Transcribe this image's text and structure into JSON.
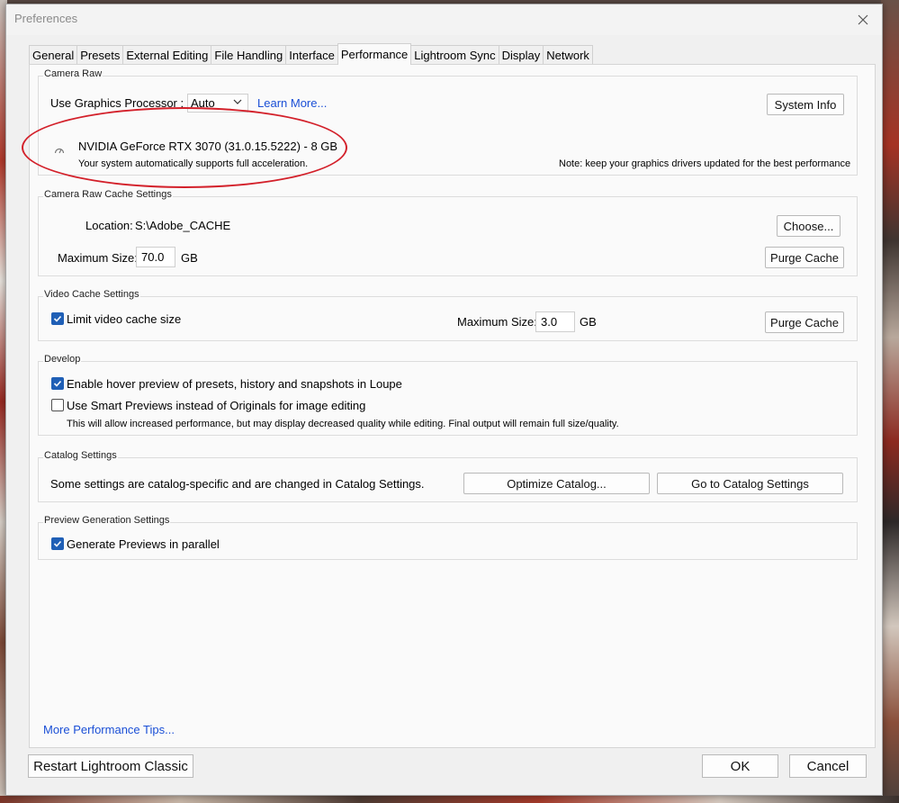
{
  "window": {
    "title": "Preferences"
  },
  "tabs": [
    {
      "label": "General",
      "active": false
    },
    {
      "label": "Presets",
      "active": false
    },
    {
      "label": "External Editing",
      "active": false
    },
    {
      "label": "File Handling",
      "active": false
    },
    {
      "label": "Interface",
      "active": false
    },
    {
      "label": "Performance",
      "active": true
    },
    {
      "label": "Lightroom Sync",
      "active": false
    },
    {
      "label": "Display",
      "active": false
    },
    {
      "label": "Network",
      "active": false
    }
  ],
  "camera_raw": {
    "section_label": "Camera Raw",
    "gpu_label": "Use Graphics Processor :",
    "gpu_select_value": "Auto",
    "learn_more": "Learn More...",
    "system_info_button": "System Info",
    "gpu_name": "NVIDIA GeForce RTX 3070 (31.0.15.5222) - 8 GB",
    "gpu_status": "Your system automatically supports full acceleration.",
    "driver_note": "Note: keep your graphics drivers updated for the best performance"
  },
  "cache": {
    "section_label": "Camera Raw Cache Settings",
    "location_label": "Location:",
    "location_value": "S:\\Adobe_CACHE",
    "choose_button": "Choose...",
    "max_size_label": "Maximum Size:",
    "max_size_value": "70.0",
    "unit": "GB",
    "purge_button": "Purge Cache"
  },
  "video_cache": {
    "section_label": "Video Cache Settings",
    "limit_label": "Limit video cache size",
    "limit_checked": true,
    "max_size_label": "Maximum Size:",
    "max_size_value": "3.0",
    "unit": "GB",
    "purge_button": "Purge Cache"
  },
  "develop": {
    "section_label": "Develop",
    "hover_label": "Enable hover preview of presets, history and snapshots in Loupe",
    "hover_checked": true,
    "smart_label": "Use Smart Previews instead of Originals for image editing",
    "smart_checked": false,
    "smart_note": "This will allow increased performance, but may display decreased quality while editing. Final output will remain full size/quality."
  },
  "catalog": {
    "section_label": "Catalog Settings",
    "note": "Some settings are catalog-specific and are changed in Catalog Settings.",
    "optimize_button": "Optimize Catalog...",
    "goto_button": "Go to Catalog Settings"
  },
  "preview": {
    "section_label": "Preview Generation Settings",
    "parallel_label": "Generate Previews in parallel",
    "parallel_checked": true
  },
  "more_tips": "More Performance Tips...",
  "footer": {
    "restart_button": "Restart Lightroom Classic",
    "ok_button": "OK",
    "cancel_button": "Cancel"
  },
  "colors": {
    "accent": "#1f5fb6",
    "link": "#1a4fd6",
    "highlight_ellipse": "#d3202a"
  },
  "icons": {
    "close": "close-icon",
    "chevron": "chevron-down-icon",
    "gauge": "gauge-icon",
    "check": "checkmark-icon"
  }
}
